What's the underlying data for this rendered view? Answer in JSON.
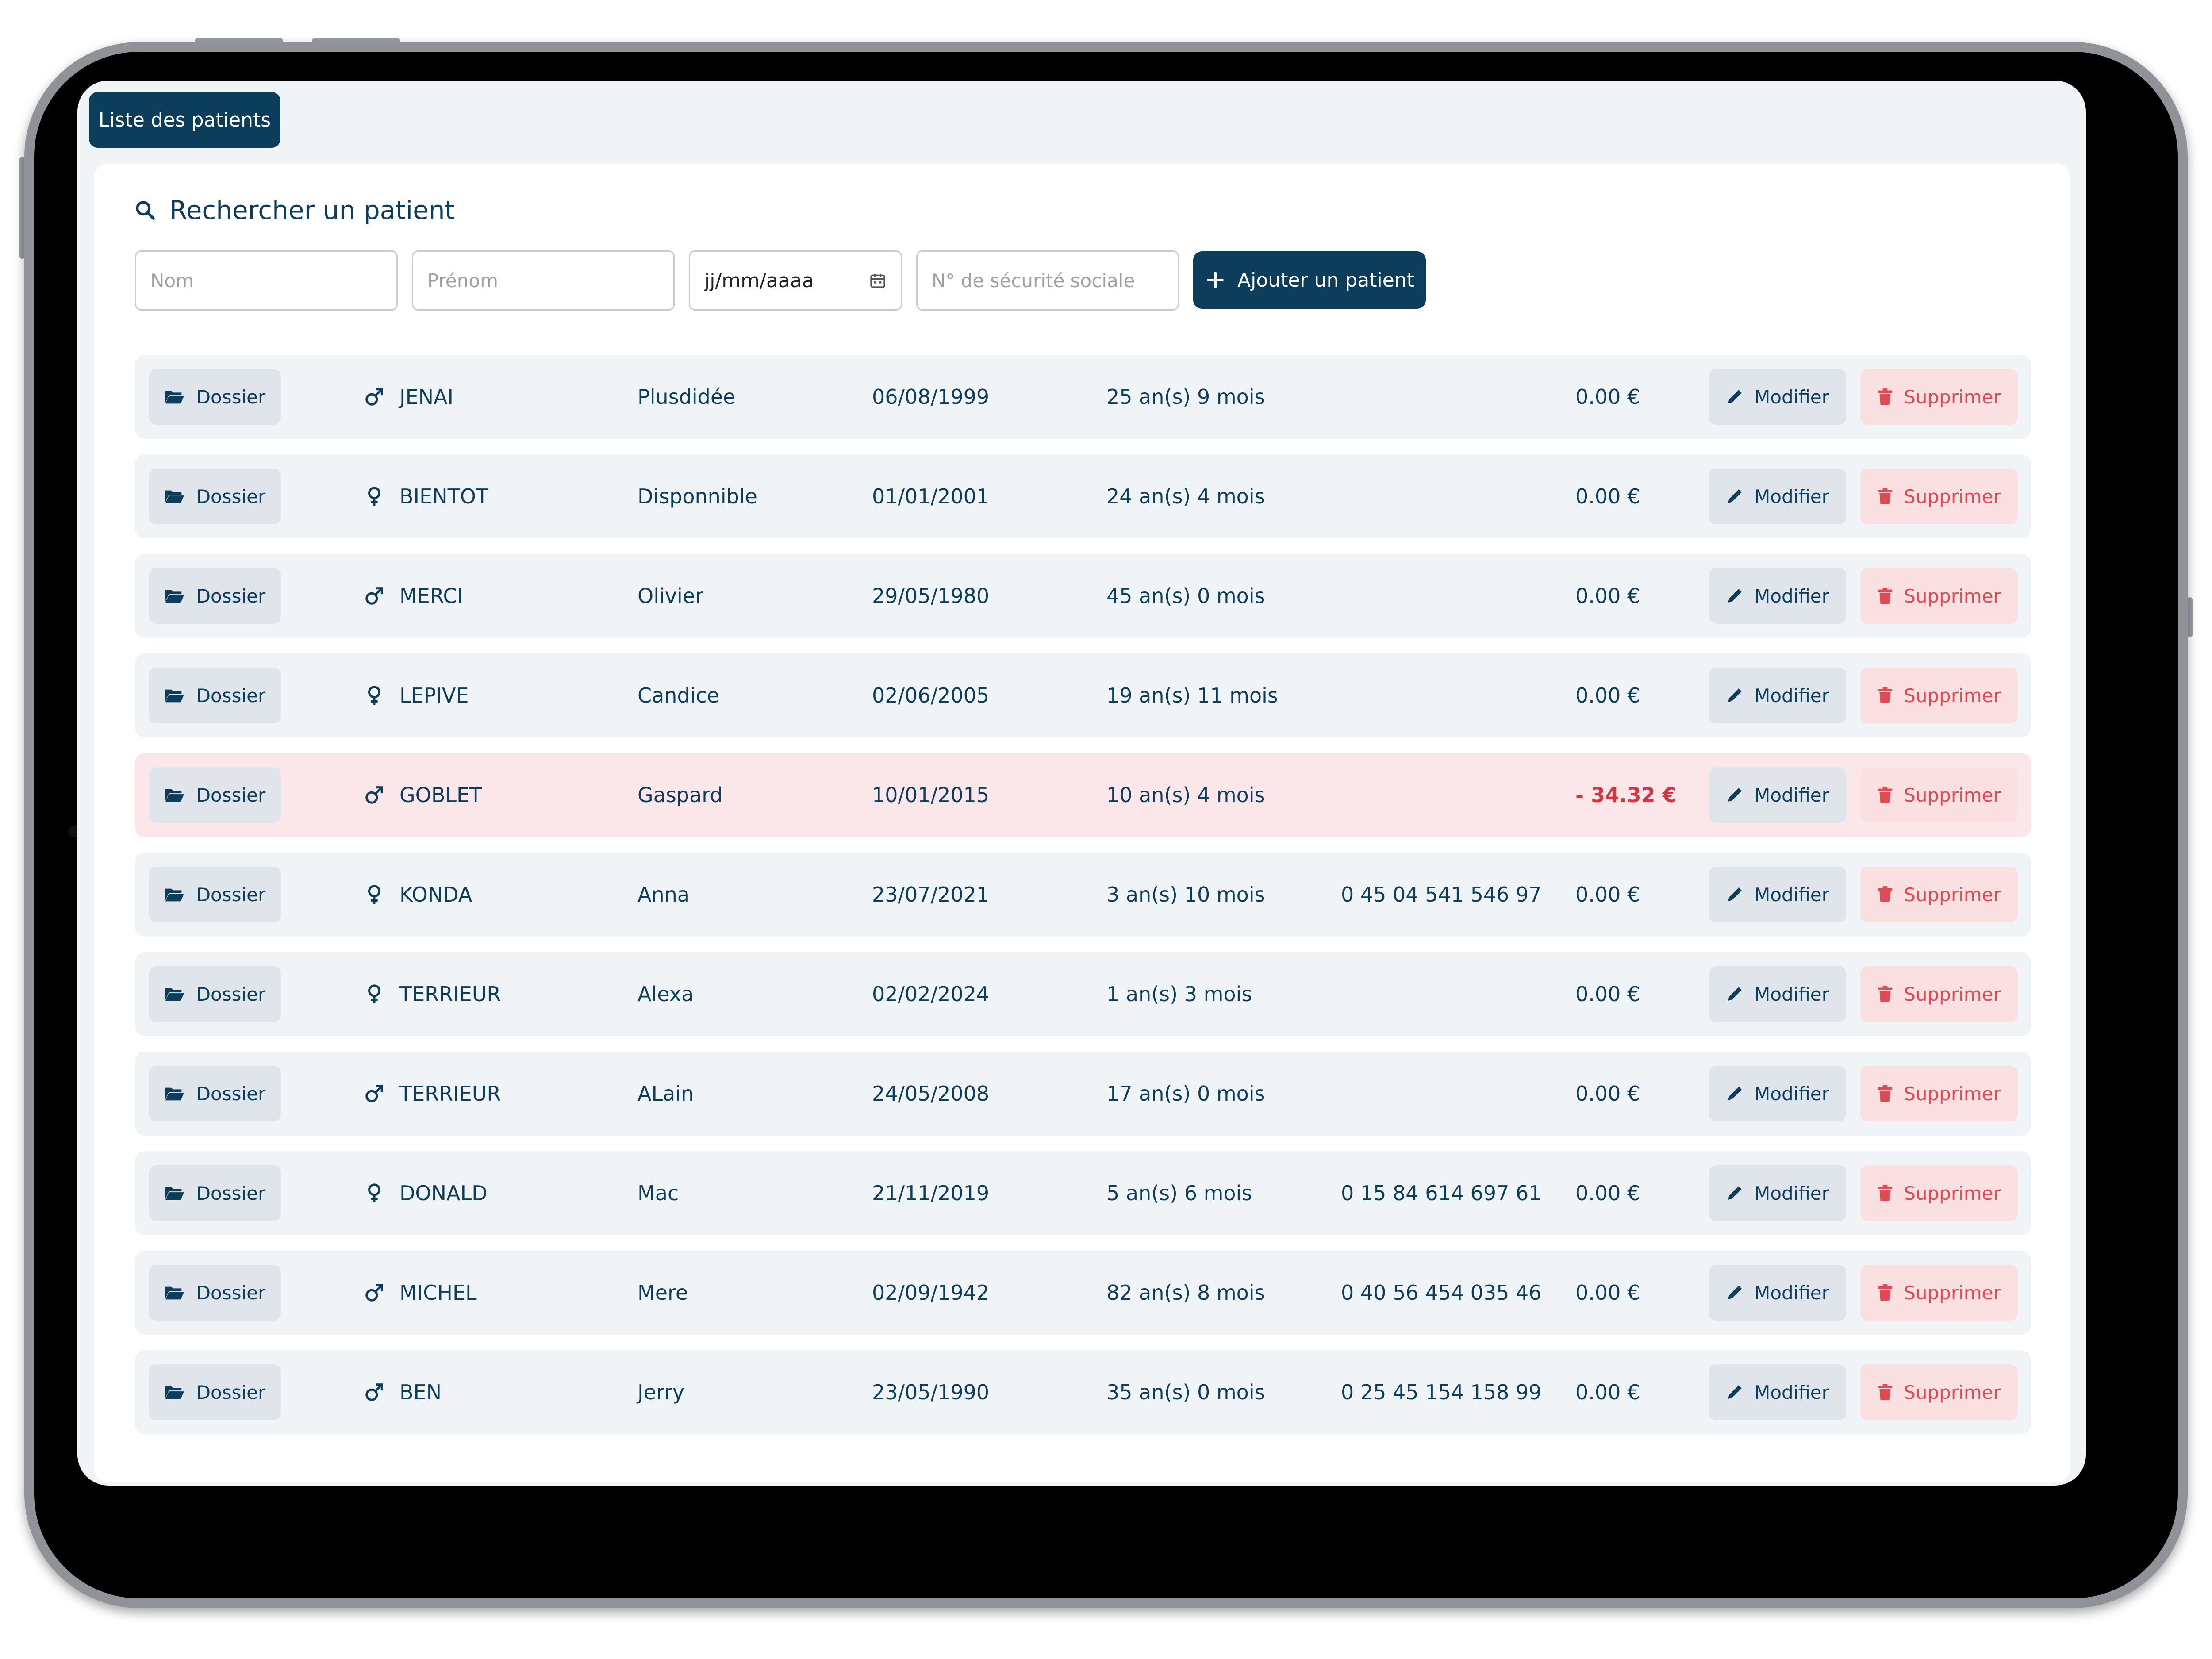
{
  "tab": {
    "label": "Liste des patients"
  },
  "search": {
    "title": "Rechercher un patient",
    "nom_placeholder": "Nom",
    "prenom_placeholder": "Prénom",
    "date_placeholder": "jj/mm/aaaa",
    "ssn_placeholder": "N° de sécurité sociale",
    "add_label": "Ajouter un patient"
  },
  "labels": {
    "dossier": "Dossier",
    "modifier": "Modifier",
    "supprimer": "Supprimer"
  },
  "icons": {
    "search": "search-icon",
    "calendar": "calendar-icon",
    "plus": "plus-icon",
    "folder": "folder-open-icon",
    "male": "male-icon",
    "female": "female-icon",
    "pencil": "pencil-icon",
    "trash": "trash-icon"
  },
  "colors": {
    "primary": "#0c3d5b",
    "row_bg": "#f1f4f7",
    "row_negative_bg": "#fbe7e9",
    "danger": "#e04a52"
  },
  "patients": [
    {
      "gender": "male",
      "nom": "JENAI",
      "prenom": "Plusdidée",
      "dob": "06/08/1999",
      "age": "25 an(s) 9 mois",
      "phone": "",
      "balance": "0.00 €",
      "negative": false
    },
    {
      "gender": "female",
      "nom": "BIENTOT",
      "prenom": "Disponnible",
      "dob": "01/01/2001",
      "age": "24 an(s) 4 mois",
      "phone": "",
      "balance": "0.00 €",
      "negative": false
    },
    {
      "gender": "male",
      "nom": "MERCI",
      "prenom": "Olivier",
      "dob": "29/05/1980",
      "age": "45 an(s) 0 mois",
      "phone": "",
      "balance": "0.00 €",
      "negative": false
    },
    {
      "gender": "female",
      "nom": "LEPIVE",
      "prenom": "Candice",
      "dob": "02/06/2005",
      "age": "19 an(s) 11 mois",
      "phone": "",
      "balance": "0.00 €",
      "negative": false
    },
    {
      "gender": "male",
      "nom": "GOBLET",
      "prenom": "Gaspard",
      "dob": "10/01/2015",
      "age": "10 an(s) 4 mois",
      "phone": "",
      "balance": "- 34.32 €",
      "negative": true
    },
    {
      "gender": "female",
      "nom": "KONDA",
      "prenom": "Anna",
      "dob": "23/07/2021",
      "age": "3 an(s) 10 mois",
      "phone": "0 45 04 541 546 97",
      "balance": "0.00 €",
      "negative": false
    },
    {
      "gender": "female",
      "nom": "TERRIEUR",
      "prenom": "Alexa",
      "dob": "02/02/2024",
      "age": "1 an(s) 3 mois",
      "phone": "",
      "balance": "0.00 €",
      "negative": false
    },
    {
      "gender": "male",
      "nom": "TERRIEUR",
      "prenom": "ALain",
      "dob": "24/05/2008",
      "age": "17 an(s) 0 mois",
      "phone": "",
      "balance": "0.00 €",
      "negative": false
    },
    {
      "gender": "female",
      "nom": "DONALD",
      "prenom": "Mac",
      "dob": "21/11/2019",
      "age": "5 an(s) 6 mois",
      "phone": "0 15 84 614 697 61",
      "balance": "0.00 €",
      "negative": false
    },
    {
      "gender": "male",
      "nom": "MICHEL",
      "prenom": "Mere",
      "dob": "02/09/1942",
      "age": "82 an(s) 8 mois",
      "phone": "0 40 56 454 035 46",
      "balance": "0.00 €",
      "negative": false
    },
    {
      "gender": "male",
      "nom": "BEN",
      "prenom": "Jerry",
      "dob": "23/05/1990",
      "age": "35 an(s) 0 mois",
      "phone": "0 25 45 154 158 99",
      "balance": "0.00 €",
      "negative": false
    }
  ]
}
